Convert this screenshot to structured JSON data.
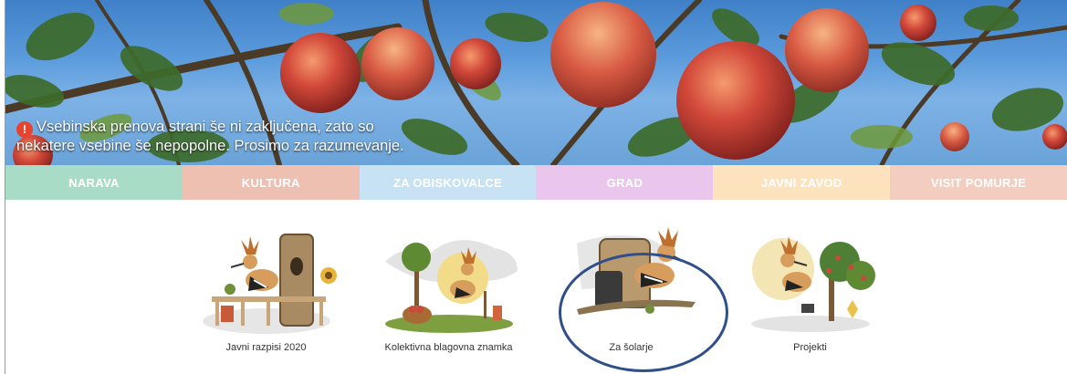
{
  "notice": {
    "icon": "exclamation-circle-icon",
    "line1": "Vsebinska prenova strani še ni zaključena, zato so",
    "line2": "nekatere vsebine še nepopolne. Prosimo za razumevanje."
  },
  "nav": {
    "items": [
      {
        "label": "NARAVA",
        "color": "#a8dcc7"
      },
      {
        "label": "KULTURA",
        "color": "#eec0b2"
      },
      {
        "label": "ZA OBISKOVALCE",
        "color": "#c7e3f3"
      },
      {
        "label": "GRAD",
        "color": "#ebc6ec"
      },
      {
        "label": "JAVNI ZAVOD",
        "color": "#fde3bd"
      },
      {
        "label": "VISIT POMURJE",
        "color": "#f3cdbf"
      }
    ]
  },
  "cards": [
    {
      "label": "Javni razpisi 2020",
      "icon": "hoopoe-tree-stump-illustration"
    },
    {
      "label": "Kolektivna blagovna znamka",
      "icon": "hoopoe-basket-illustration"
    },
    {
      "label": "Za šolarje",
      "icon": "hoopoe-schoolbag-illustration"
    },
    {
      "label": "Projekti",
      "icon": "hoopoe-apple-tree-illustration"
    }
  ],
  "highlight": {
    "color": "#2f4f8a"
  }
}
